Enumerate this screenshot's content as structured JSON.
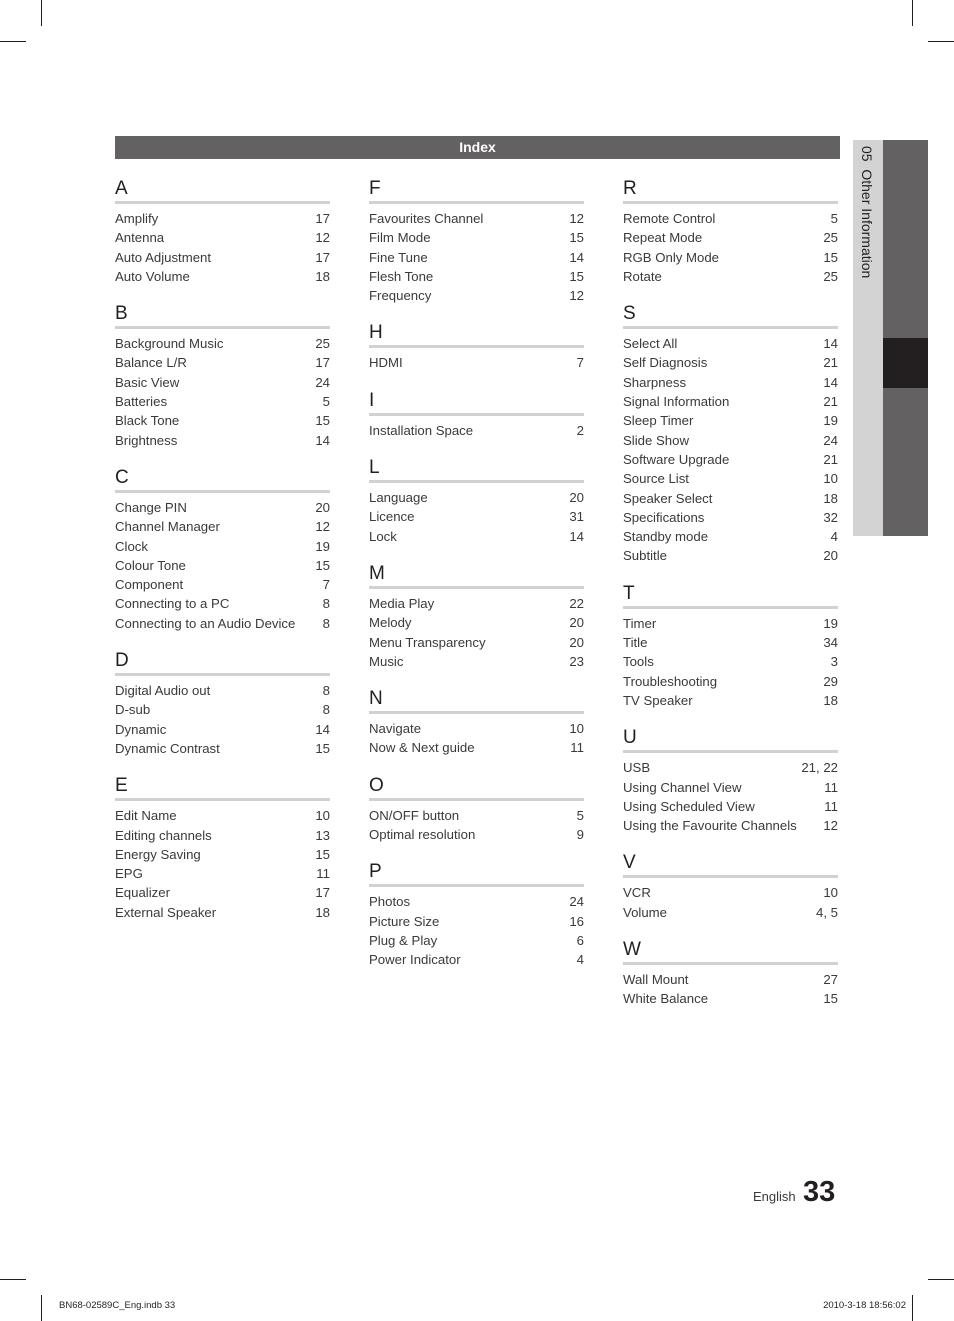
{
  "header": {
    "title": "Index"
  },
  "sidebar": {
    "chapter": "05",
    "label": "Other Information"
  },
  "columns": [
    {
      "sections": [
        {
          "letter": "A",
          "entries": [
            {
              "term": "Amplify",
              "page": "17"
            },
            {
              "term": "Antenna",
              "page": "12"
            },
            {
              "term": "Auto Adjustment",
              "page": "17"
            },
            {
              "term": "Auto Volume",
              "page": "18"
            }
          ]
        },
        {
          "letter": "B",
          "entries": [
            {
              "term": "Background Music",
              "page": "25"
            },
            {
              "term": "Balance L/R",
              "page": "17"
            },
            {
              "term": "Basic View",
              "page": "24"
            },
            {
              "term": "Batteries",
              "page": "5"
            },
            {
              "term": "Black Tone",
              "page": "15"
            },
            {
              "term": "Brightness",
              "page": "14"
            }
          ]
        },
        {
          "letter": "C",
          "entries": [
            {
              "term": "Change PIN",
              "page": "20"
            },
            {
              "term": "Channel Manager",
              "page": "12"
            },
            {
              "term": "Clock",
              "page": "19"
            },
            {
              "term": "Colour Tone",
              "page": "15"
            },
            {
              "term": "Component",
              "page": "7"
            },
            {
              "term": "Connecting to a PC",
              "page": "8"
            },
            {
              "term": "Connecting to an Audio Device",
              "page": "8"
            }
          ]
        },
        {
          "letter": "D",
          "entries": [
            {
              "term": "Digital Audio out",
              "page": "8"
            },
            {
              "term": "D-sub",
              "page": "8"
            },
            {
              "term": "Dynamic",
              "page": "14"
            },
            {
              "term": "Dynamic Contrast",
              "page": "15"
            }
          ]
        },
        {
          "letter": "E",
          "entries": [
            {
              "term": "Edit Name",
              "page": "10"
            },
            {
              "term": "Editing channels",
              "page": "13"
            },
            {
              "term": "Energy Saving",
              "page": "15"
            },
            {
              "term": "EPG",
              "page": "11"
            },
            {
              "term": "Equalizer",
              "page": "17"
            },
            {
              "term": "External Speaker",
              "page": "18"
            }
          ]
        }
      ]
    },
    {
      "sections": [
        {
          "letter": "F",
          "entries": [
            {
              "term": "Favourites Channel",
              "page": "12"
            },
            {
              "term": "Film Mode",
              "page": "15"
            },
            {
              "term": "Fine Tune",
              "page": "14"
            },
            {
              "term": "Flesh Tone",
              "page": "15"
            },
            {
              "term": "Frequency",
              "page": "12"
            }
          ]
        },
        {
          "letter": "H",
          "entries": [
            {
              "term": "HDMI",
              "page": "7"
            }
          ]
        },
        {
          "letter": "I",
          "entries": [
            {
              "term": "Installation Space",
              "page": "2"
            }
          ]
        },
        {
          "letter": "L",
          "entries": [
            {
              "term": "Language",
              "page": "20"
            },
            {
              "term": "Licence",
              "page": "31"
            },
            {
              "term": "Lock",
              "page": "14"
            }
          ]
        },
        {
          "letter": "M",
          "entries": [
            {
              "term": "Media Play",
              "page": "22"
            },
            {
              "term": "Melody",
              "page": "20"
            },
            {
              "term": "Menu Transparency",
              "page": "20"
            },
            {
              "term": "Music",
              "page": "23"
            }
          ]
        },
        {
          "letter": "N",
          "entries": [
            {
              "term": "Navigate",
              "page": "10"
            },
            {
              "term": "Now & Next guide",
              "page": "11"
            }
          ]
        },
        {
          "letter": "O",
          "entries": [
            {
              "term": "ON/OFF button",
              "page": "5"
            },
            {
              "term": "Optimal resolution",
              "page": "9"
            }
          ]
        },
        {
          "letter": "P",
          "entries": [
            {
              "term": "Photos",
              "page": "24"
            },
            {
              "term": "Picture Size",
              "page": "16"
            },
            {
              "term": "Plug & Play",
              "page": "6"
            },
            {
              "term": "Power Indicator",
              "page": "4"
            }
          ]
        }
      ]
    },
    {
      "sections": [
        {
          "letter": "R",
          "entries": [
            {
              "term": "Remote Control",
              "page": "5"
            },
            {
              "term": "Repeat Mode",
              "page": "25"
            },
            {
              "term": "RGB Only Mode",
              "page": "15"
            },
            {
              "term": "Rotate",
              "page": "25"
            }
          ]
        },
        {
          "letter": "S",
          "entries": [
            {
              "term": "Select All",
              "page": "14"
            },
            {
              "term": "Self Diagnosis",
              "page": "21"
            },
            {
              "term": "Sharpness",
              "page": "14"
            },
            {
              "term": "Signal Information",
              "page": "21"
            },
            {
              "term": "Sleep Timer",
              "page": "19"
            },
            {
              "term": "Slide Show",
              "page": "24"
            },
            {
              "term": "Software Upgrade",
              "page": "21"
            },
            {
              "term": "Source List",
              "page": "10"
            },
            {
              "term": "Speaker Select",
              "page": "18"
            },
            {
              "term": "Specifications",
              "page": "32"
            },
            {
              "term": "Standby mode",
              "page": "4"
            },
            {
              "term": "Subtitle",
              "page": "20"
            }
          ]
        },
        {
          "letter": "T",
          "entries": [
            {
              "term": "Timer",
              "page": "19"
            },
            {
              "term": "Title",
              "page": "34"
            },
            {
              "term": "Tools",
              "page": "3"
            },
            {
              "term": "Troubleshooting",
              "page": "29"
            },
            {
              "term": "TV Speaker",
              "page": "18"
            }
          ]
        },
        {
          "letter": "U",
          "entries": [
            {
              "term": "USB",
              "page": "21, 22"
            },
            {
              "term": "Using Channel View",
              "page": "11"
            },
            {
              "term": "Using Scheduled View",
              "page": "11"
            },
            {
              "term": "Using the Favourite Channels",
              "page": "12"
            }
          ]
        },
        {
          "letter": "V",
          "entries": [
            {
              "term": "VCR",
              "page": "10"
            },
            {
              "term": "Volume",
              "page": "4, 5"
            }
          ]
        },
        {
          "letter": "W",
          "entries": [
            {
              "term": "Wall Mount",
              "page": "27"
            },
            {
              "term": "White Balance",
              "page": "15"
            }
          ]
        }
      ]
    }
  ],
  "page": {
    "language": "English",
    "number": "33"
  },
  "footer": {
    "file": "BN68-02589C_Eng.indb   33",
    "timestamp": "2010-3-18   18:56:02"
  },
  "colors": {
    "header_bar": "#636162",
    "rule": "#d1d1d1",
    "side_tab_light": "#d3d3d3",
    "side_tab_active": "#231f20"
  }
}
